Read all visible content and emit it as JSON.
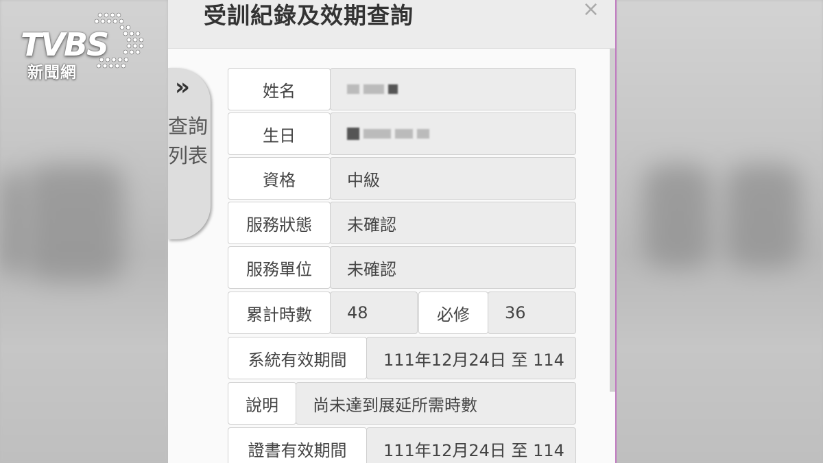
{
  "watermark": {
    "brand": "TVBS",
    "sub": "新聞網"
  },
  "dialog": {
    "title": "受訓紀錄及效期查詢",
    "close_glyph": "×",
    "side_tab": {
      "chevron": "»",
      "line1": "查詢",
      "line2": "列表"
    }
  },
  "fields": {
    "name_label": "姓名",
    "birthday_label": "生日",
    "qualification_label": "資格",
    "qualification_value": "中級",
    "service_status_label": "服務狀態",
    "service_status_value": "未確認",
    "service_unit_label": "服務單位",
    "service_unit_value": "未確認",
    "total_hours_label": "累計時數",
    "total_hours_value": "48",
    "required_label": "必修",
    "required_value": "36",
    "system_validity_label": "系統有效期間",
    "system_validity_value": "111年12月24日 至 114",
    "note_label": "說明",
    "note_value": "尚未達到展延所需時數",
    "cert_validity_label": "證書有效期間",
    "cert_validity_value": "111年12月24日 至 114"
  }
}
